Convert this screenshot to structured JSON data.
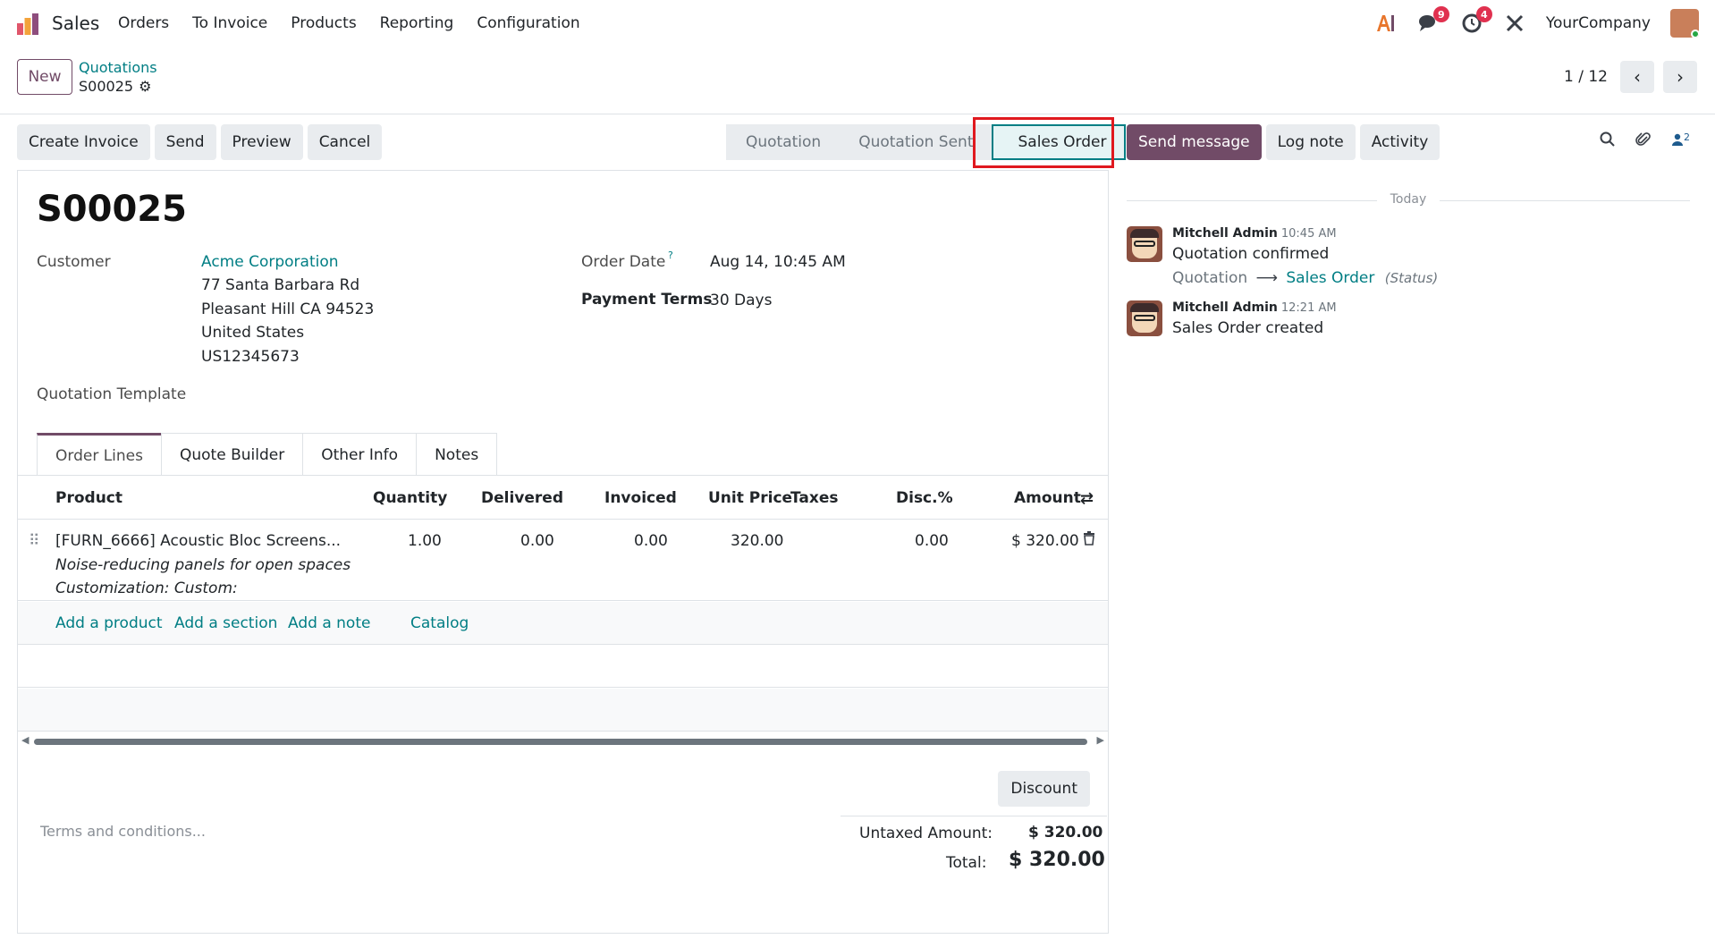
{
  "app": {
    "name": "Sales",
    "menu": [
      "Orders",
      "To Invoice",
      "Products",
      "Reporting",
      "Configuration"
    ],
    "company": "YourCompany",
    "messages_badge": "9",
    "activities_badge": "4"
  },
  "control": {
    "new_label": "New",
    "breadcrumb_parent": "Quotations",
    "breadcrumb_current": "S00025",
    "pager": "1 / 12"
  },
  "actions": [
    "Create Invoice",
    "Send",
    "Preview",
    "Cancel"
  ],
  "status_stages": [
    "Quotation",
    "Quotation Sent",
    "Sales Order"
  ],
  "current_stage": "Sales Order",
  "order": {
    "name": "S00025",
    "customer_label": "Customer",
    "customer_name": "Acme Corporation",
    "address_lines": [
      "77 Santa Barbara Rd",
      "Pleasant Hill CA 94523",
      "United States",
      "US12345673"
    ],
    "template_label": "Quotation Template",
    "order_date_label": "Order Date",
    "order_date_help": "?",
    "order_date": "Aug 14, 10:45 AM",
    "payment_terms_label": "Payment Terms",
    "payment_terms": "30 Days"
  },
  "tabs": [
    "Order Lines",
    "Quote Builder",
    "Other Info",
    "Notes"
  ],
  "table": {
    "headers": [
      "Product",
      "Quantity",
      "Delivered",
      "Invoiced",
      "Unit Price",
      "Taxes",
      "Disc.%",
      "Amount"
    ],
    "line": {
      "product": "[FURN_6666] Acoustic Bloc Screens...",
      "description1": "Noise-reducing panels for open spaces",
      "description2": "Customization: Custom:",
      "quantity": "1.00",
      "delivered": "0.00",
      "invoiced": "0.00",
      "unit_price": "320.00",
      "discount": "0.00",
      "amount": "$ 320.00"
    },
    "add_links": [
      "Add a product",
      "Add a section",
      "Add a note",
      "Catalog"
    ]
  },
  "footer": {
    "discount_button": "Discount",
    "terms_placeholder": "Terms and conditions...",
    "untaxed_label": "Untaxed Amount:",
    "untaxed_value": "$ 320.00",
    "total_label": "Total:",
    "total_value": "$ 320.00"
  },
  "chatter": {
    "send_message": "Send message",
    "log_note": "Log note",
    "activity": "Activity",
    "followers_count": "2",
    "today": "Today",
    "messages": [
      {
        "author": "Mitchell Admin",
        "time": "10:45 AM",
        "body": "Quotation confirmed",
        "track_from": "Quotation",
        "track_arrow": "⟶",
        "track_to": "Sales Order",
        "track_field": "(Status)"
      },
      {
        "author": "Mitchell Admin",
        "time": "12:21 AM",
        "body": "Sales Order created"
      }
    ]
  },
  "colors": {
    "brand": "#714b67",
    "link": "#017e84",
    "highlight": "#e0191f",
    "badge": "#e0314f"
  }
}
